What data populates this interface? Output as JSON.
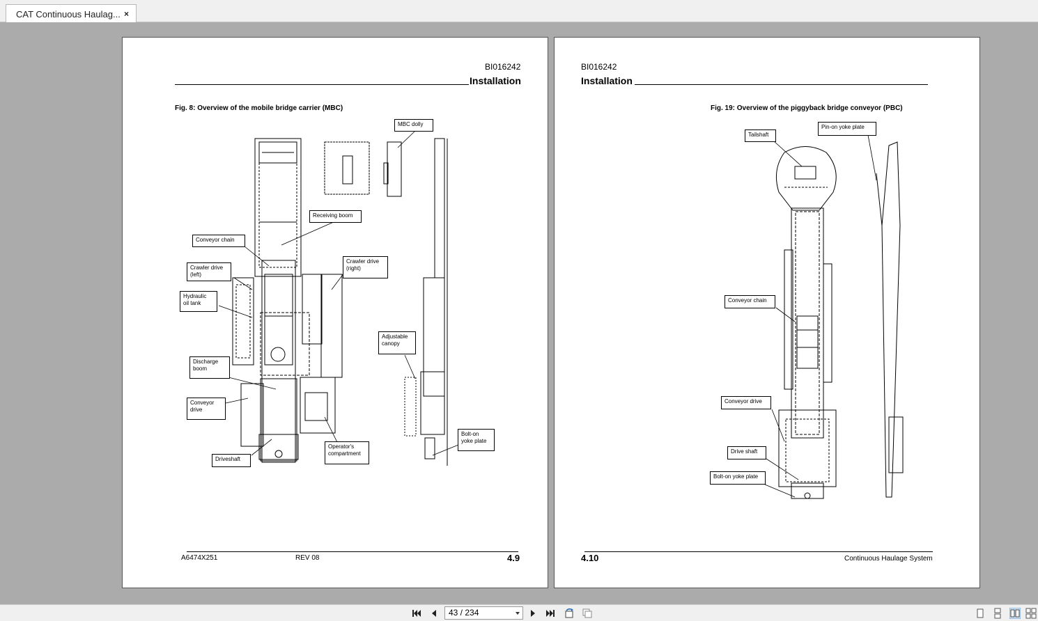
{
  "tab": {
    "title": "CAT Continuous Haulag...",
    "close_glyph": "×"
  },
  "left_page": {
    "doc_id": "BI016242",
    "section": "Installation",
    "figure_title": "Fig. 8: Overview of the mobile bridge carrier (MBC)",
    "callouts": {
      "mbc_dolly": "MBC dolly",
      "receiving_boom": "Receiving boom",
      "conveyor_chain": "Conveyor chain",
      "crawler_drive_left": "Crawler drive\n(left)",
      "crawler_drive_right": "Crawler drive\n(right)",
      "hydraulic_oil_tank": "Hydraulic\noil tank",
      "adjustable_canopy": "Adjustable\ncanopy",
      "discharge_boom": "Discharge\nboom",
      "conveyor_drive": "Conveyor\ndrive",
      "bolt_on_yoke_plate": "Bolt-on\nyoke plate",
      "operators_compartment": "Operator's\ncompartment",
      "driveshaft": "Driveshaft"
    },
    "footer_left": "A6474X251",
    "footer_mid": "REV 08",
    "page_number": "4.9"
  },
  "right_page": {
    "doc_id": "BI016242",
    "section": "Installation",
    "figure_title": "Fig. 19: Overview of the piggyback bridge conveyor (PBC)",
    "callouts": {
      "tailshaft": "Tailshaft",
      "pin_on_yoke_plate": "Pin-on yoke plate",
      "conveyor_chain": "Conveyor chain",
      "conveyor_drive": "Conveyor drive",
      "drive_shaft": "Drive shaft",
      "bolt_on_yoke_plate": "Bolt-on yoke plate"
    },
    "page_number": "4.10",
    "footer_right": "Continuous Haulage System"
  },
  "toolbar": {
    "page_indicator": "43 / 234",
    "icons": [
      "first-page-icon",
      "prev-page-icon",
      "next-page-icon",
      "last-page-icon",
      "rotate-icon",
      "copy-icon",
      "single-page-view-icon",
      "continuous-view-icon",
      "two-page-view-icon",
      "two-page-continuous-view-icon"
    ]
  }
}
